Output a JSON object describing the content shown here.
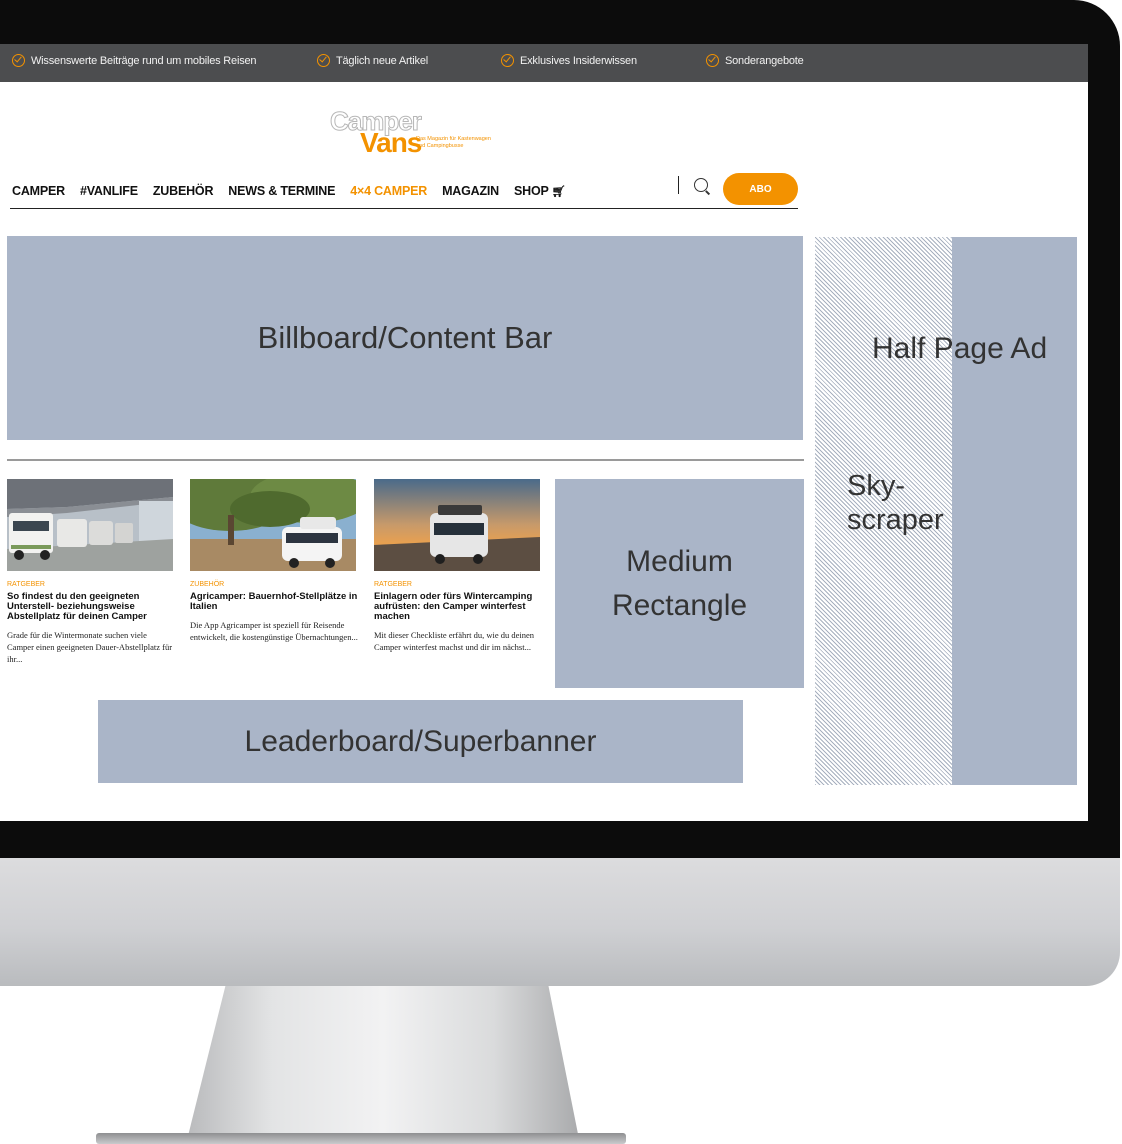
{
  "topbar": {
    "items": [
      {
        "label": "Wissenswerte Beiträge rund um mobiles Reisen",
        "icon": "check-circle-icon"
      },
      {
        "label": "Täglich neue Artikel",
        "icon": "check-circle-icon"
      },
      {
        "label": "Exklusives Insiderwissen",
        "icon": "check-circle-icon"
      },
      {
        "label": "Sonderangebote",
        "icon": "check-circle-icon"
      }
    ]
  },
  "logo": {
    "word1": "Camper",
    "word2": "Vans",
    "tagline": "Das Magazin für Kastenwagen und Campingbusse"
  },
  "nav": {
    "items": [
      "CAMPER",
      "#VANLIFE",
      "ZUBEHÖR",
      "NEWS & TERMINE",
      "4×4 CAMPER",
      "MAGAZIN",
      "SHOP"
    ],
    "active": "4×4 CAMPER",
    "cta": "ABO"
  },
  "ads": {
    "billboard": "Billboard/Content Bar",
    "medium_rectangle_line1": "Medium",
    "medium_rectangle_line2": "Rectangle",
    "leaderboard": "Leaderboard/Superbanner",
    "half_page": "Half Page Ad",
    "skyscraper_line1": "Sky-",
    "skyscraper_line2": "scraper"
  },
  "articles": [
    {
      "category": "RATGEBER",
      "title": "So findest du den geeigneten Unterstell- beziehungsweise Abstellplatz für deinen Camper",
      "excerpt": "Grade für die Wintermonate suchen viele Camper einen geeigneten Dauer-Abstellplatz für ihr..."
    },
    {
      "category": "ZUBEHÖR",
      "title": "Agricamper: Bauernhof-Stellplätze in Italien",
      "excerpt": "Die App Agricamper ist speziell für Reisende entwickelt, die kostengünstige Übernachtungen..."
    },
    {
      "category": "RATGEBER",
      "title": "Einlagern oder fürs Wintercamping aufrüsten: den Camper winterfest machen",
      "excerpt": "Mit dieser Checkliste erfährt du, wie du deinen Camper winterfest machst und dir im nächst..."
    }
  ],
  "colors": {
    "accent": "#f39200",
    "topbar": "#4c4d4f",
    "ad_slot": "#aab5c8"
  }
}
